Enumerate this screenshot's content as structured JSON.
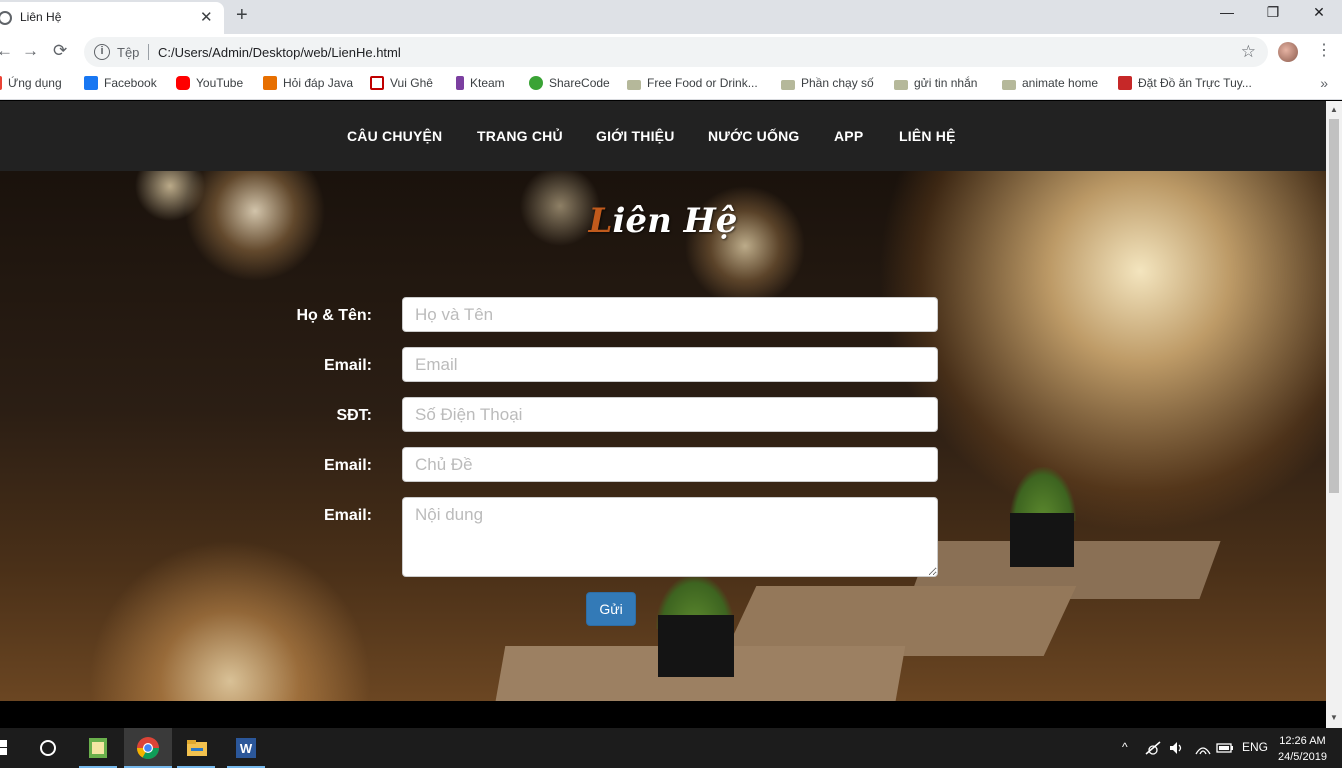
{
  "browser": {
    "tab_title": "Liên Hệ",
    "tab_close": "✕",
    "new_tab": "+",
    "window_controls": {
      "minimize": "—",
      "maximize": "❐",
      "close": "✕"
    },
    "nav": {
      "back": "←",
      "forward": "→",
      "reload": "⟳"
    },
    "scheme_label": "Tệp",
    "url": "C:/Users/Admin/Desktop/web/LienHe.html",
    "bookmark_star": "☆",
    "menu": "⋮",
    "bookmarks_more": "»",
    "bookmarks": [
      {
        "label": "Ứng dụng",
        "icon": "apps-grid-icon",
        "color": "#ea4335"
      },
      {
        "label": "Facebook",
        "icon": "facebook-icon",
        "color": "#1877f2"
      },
      {
        "label": "YouTube",
        "icon": "youtube-icon",
        "color": "#ff0000"
      },
      {
        "label": "Hỏi đáp Java",
        "icon": "java-icon",
        "color": "#e76f00"
      },
      {
        "label": "Vui Ghê",
        "icon": "play-icon",
        "color": "#c00000"
      },
      {
        "label": "Kteam",
        "icon": "kteam-icon",
        "color": "#7b3fa0"
      },
      {
        "label": "ShareCode",
        "icon": "sharecode-icon",
        "color": "#3aa335"
      },
      {
        "label": "Free Food or Drink...",
        "icon": "file-icon",
        "color": "#b5b89a"
      },
      {
        "label": "Phần chạy số",
        "icon": "file-icon",
        "color": "#b5b89a"
      },
      {
        "label": "gửi tin nhắn",
        "icon": "file-icon",
        "color": "#b5b89a"
      },
      {
        "label": "animate home",
        "icon": "file-icon",
        "color": "#b5b89a"
      },
      {
        "label": "Đặt Đồ ăn Trực Tuy...",
        "icon": "book-icon",
        "color": "#c62828"
      }
    ]
  },
  "site": {
    "nav": [
      "CÂU CHUYỆN",
      "TRANG CHỦ",
      "GIỚI THIỆU",
      "NƯỚC UỐNG",
      "APP",
      "LIÊN HỆ"
    ],
    "title_first": "L",
    "title_rest": "iên Hệ",
    "form": {
      "name_label": "Họ & Tên:",
      "name_placeholder": "Họ và Tên",
      "email_label": "Email:",
      "email_placeholder": "Email",
      "phone_label": "SĐT:",
      "phone_placeholder": "Số Điện Thoại",
      "subject_label": "Email:",
      "subject_placeholder": "Chủ Đề",
      "content_label": "Email:",
      "content_placeholder": "Nội dung",
      "submit_label": "Gửi"
    },
    "accent_color": "#337ab7"
  },
  "taskbar": {
    "tray_lang": "ENG",
    "tray_up": "^",
    "time": "12:26 AM",
    "date": "24/5/2019"
  }
}
